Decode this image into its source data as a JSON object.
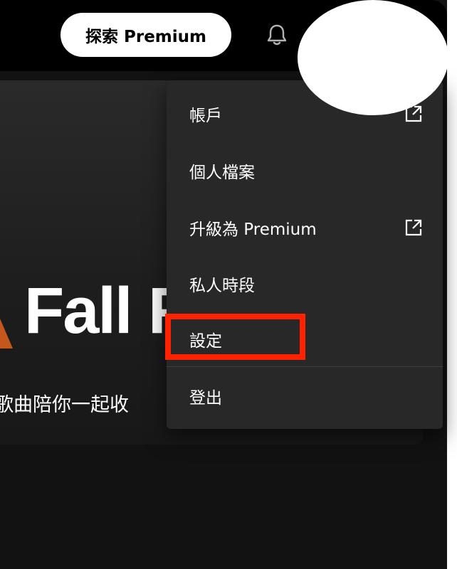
{
  "topbar": {
    "premium_button_label": "探索 Premium",
    "notifications_icon": "bell-icon"
  },
  "hero": {
    "title": "Fall F",
    "subtitle": "歌曲陪你一起收"
  },
  "account_menu": {
    "items": [
      {
        "label": "帳戶",
        "external": true,
        "icon": "external-link-icon"
      },
      {
        "label": "個人檔案",
        "external": false
      },
      {
        "label": "升級為 Premium",
        "external": true,
        "icon": "external-link-icon"
      },
      {
        "label": "私人時段",
        "external": false
      },
      {
        "label": "設定",
        "external": false,
        "highlighted": true
      },
      {
        "label": "登出",
        "external": false
      }
    ]
  },
  "colors": {
    "background": "#121212",
    "topbar": "#000000",
    "menu": "#282828",
    "highlight": "#ff2200",
    "accent_deco": "#c4581c"
  }
}
